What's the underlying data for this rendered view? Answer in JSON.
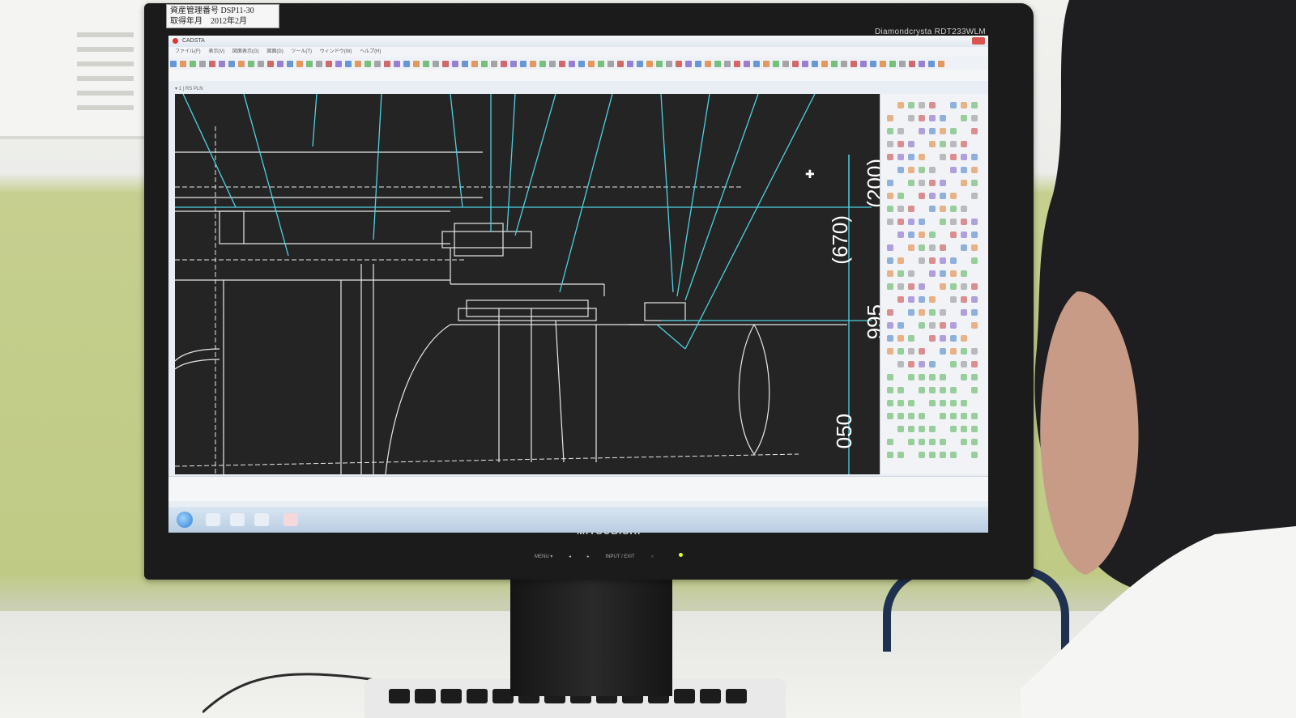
{
  "sticker": {
    "line1": "資産管理番号 DSP11-30",
    "line2": "取得年月　2012年2月"
  },
  "monitor": {
    "model": "Diamondcrysta RDT233WLM",
    "brand": "MITSUBISHI",
    "controls": [
      "MENU ▾",
      "◂",
      "▸",
      "INPUT / EXIT",
      "○"
    ]
  },
  "app": {
    "title": "CADSTA",
    "menu": [
      "ファイル(F)",
      "表示(V)",
      "図面表示(G)",
      "図面(D)",
      "ツール(T)",
      "ウィンドウ(W)",
      "ヘルプ(H)"
    ],
    "tab": "▾ 1  |  RS PLN"
  },
  "drawing": {
    "dimensions": [
      "(200)",
      "(670)",
      "995",
      "050"
    ]
  },
  "colors": {
    "cad_line": "#4fd0e0",
    "cad_bg": "#242424",
    "cad_white": "#e8e8e8"
  }
}
